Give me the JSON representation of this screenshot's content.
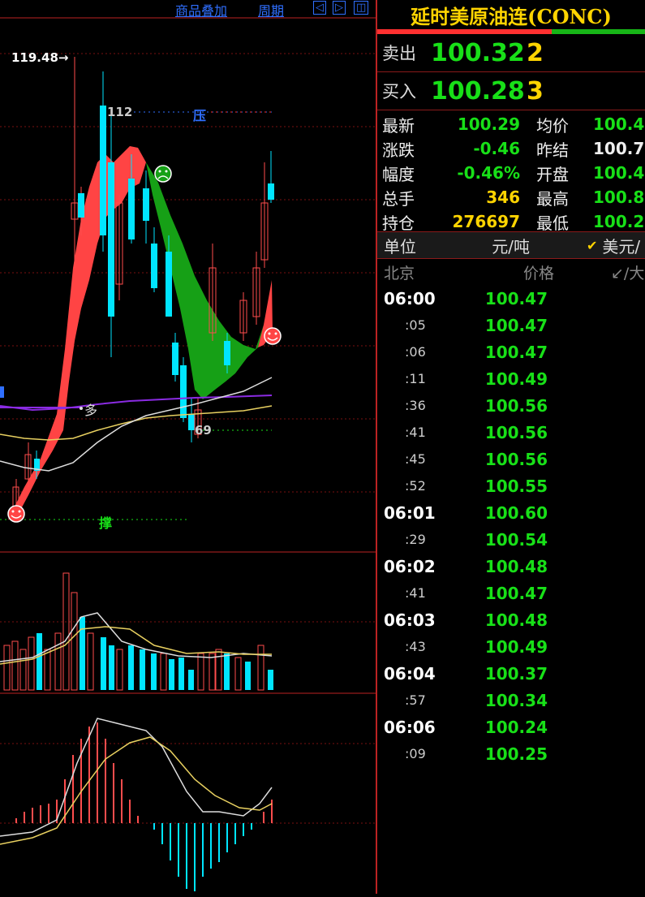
{
  "toolbar": {
    "overlay_label": "商品叠加",
    "period_label": "周期",
    "nav_left": "◁",
    "nav_right": "▷",
    "nav_split": "◫"
  },
  "chart": {
    "price_high_label": "119.48→",
    "level_112": "112",
    "pressure_label": "压",
    "support_label": "撑",
    "long_label": "多",
    "level_69": "69",
    "colors": {
      "up": "#ff4d4d",
      "down": "#00e5ff",
      "ribbon_up": "#ff4444",
      "ribbon_down": "#16a016"
    }
  },
  "quote": {
    "title": "延时美原油连(CONC)",
    "sell_label": "卖出",
    "sell_price": "100.32",
    "sell_vol": "2",
    "buy_label": "买入",
    "buy_price": "100.28",
    "buy_vol": "3"
  },
  "stats": {
    "latest_label": "最新",
    "latest": "100.29",
    "avg_label": "均价",
    "avg": "100.4",
    "change_label": "涨跌",
    "change": "-0.46",
    "prev_label": "昨结",
    "prev": "100.7",
    "amp_label": "幅度",
    "amp": "-0.46%",
    "open_label": "开盘",
    "open": "100.4",
    "volume_label": "总手",
    "volume": "346",
    "high_label": "最高",
    "high": "100.8",
    "oi_label": "持仓",
    "oi": "276697",
    "low_label": "最低",
    "low": "100.2"
  },
  "unit": {
    "label": "单位",
    "value": "元/吨",
    "check": "✔",
    "alt": "美元/"
  },
  "ticks_header": {
    "time": "北京",
    "price": "价格",
    "extra": "↙/大"
  },
  "ticks": [
    {
      "time": "06:00",
      "price": "100.47",
      "major": true
    },
    {
      "time": ":05",
      "price": "100.47",
      "major": false
    },
    {
      "time": ":06",
      "price": "100.47",
      "major": false
    },
    {
      "time": ":11",
      "price": "100.49",
      "major": false
    },
    {
      "time": ":36",
      "price": "100.56",
      "major": false
    },
    {
      "time": ":41",
      "price": "100.56",
      "major": false
    },
    {
      "time": ":45",
      "price": "100.56",
      "major": false
    },
    {
      "time": ":52",
      "price": "100.55",
      "major": false
    },
    {
      "time": "06:01",
      "price": "100.60",
      "major": true
    },
    {
      "time": ":29",
      "price": "100.54",
      "major": false
    },
    {
      "time": "06:02",
      "price": "100.48",
      "major": true
    },
    {
      "time": ":41",
      "price": "100.47",
      "major": false
    },
    {
      "time": "06:03",
      "price": "100.48",
      "major": true
    },
    {
      "time": ":43",
      "price": "100.49",
      "major": false
    },
    {
      "time": "06:04",
      "price": "100.37",
      "major": true
    },
    {
      "time": ":57",
      "price": "100.34",
      "major": false
    },
    {
      "time": "06:06",
      "price": "100.24",
      "major": true
    },
    {
      "time": ":09",
      "price": "100.25",
      "major": false
    }
  ]
}
